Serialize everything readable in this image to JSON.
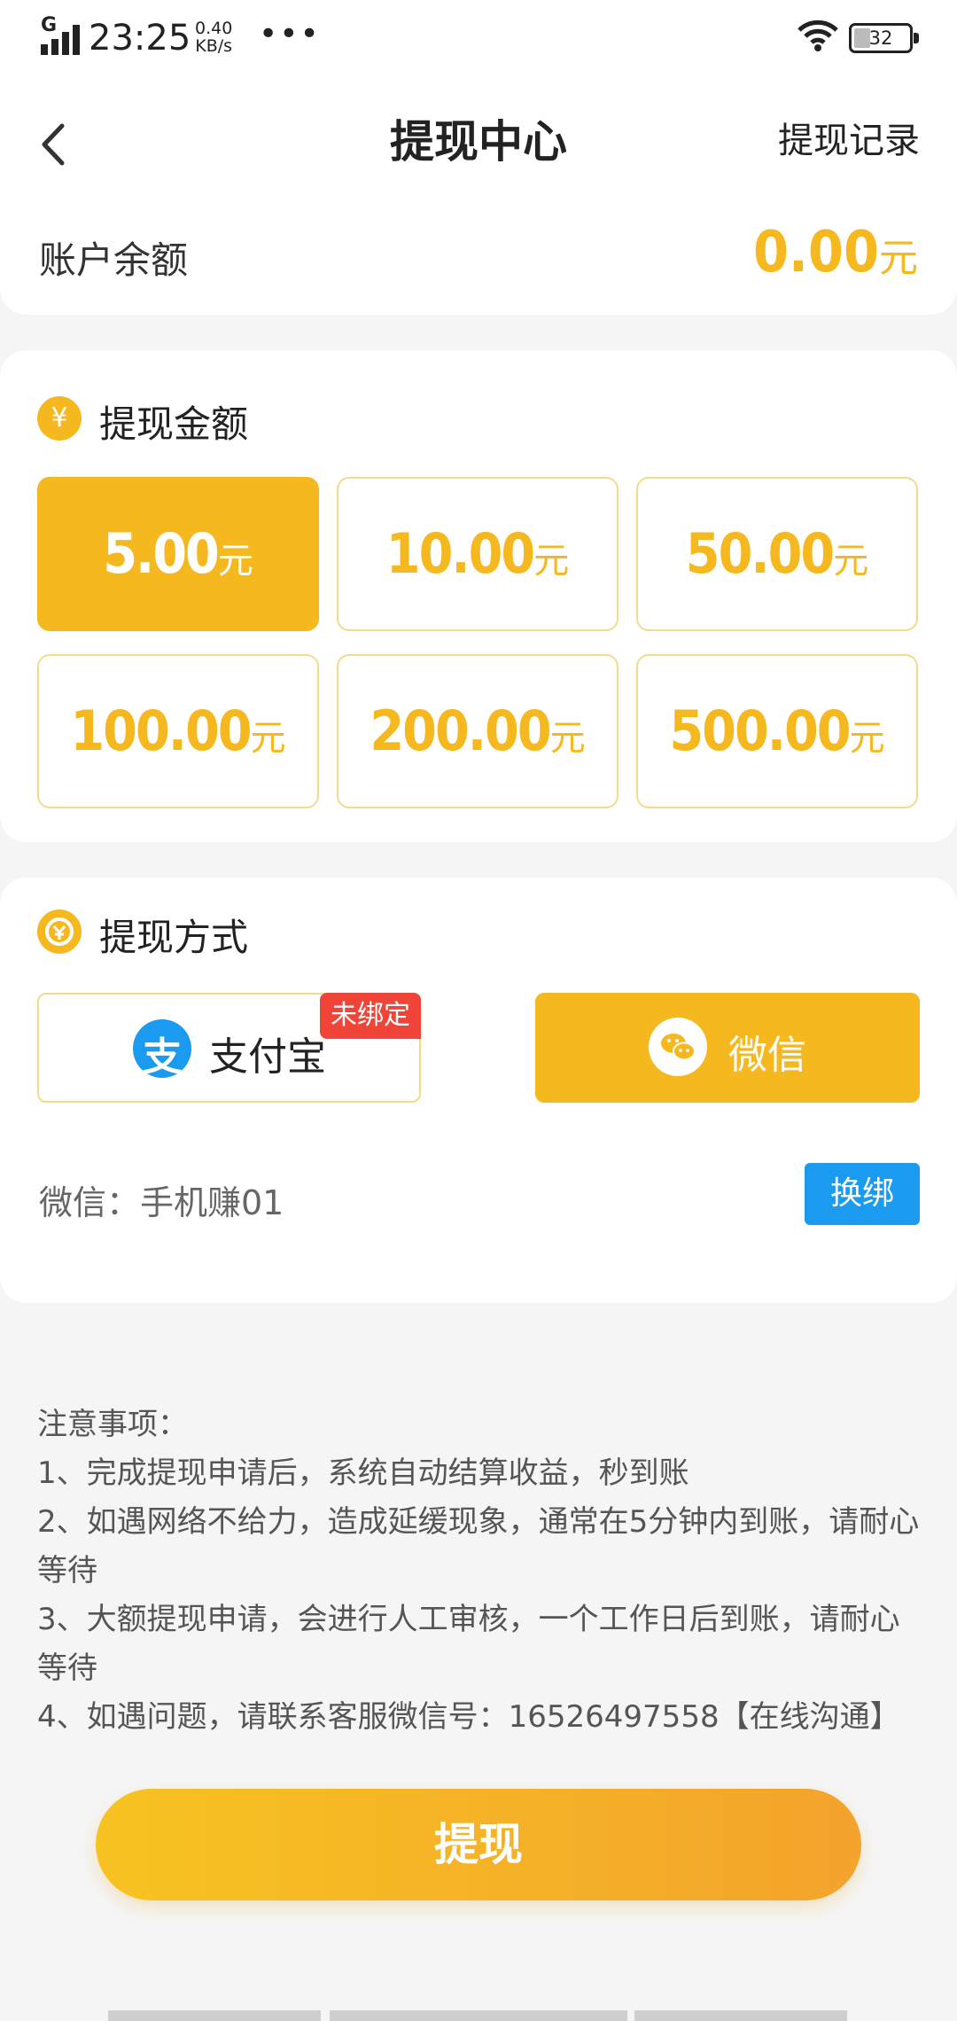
{
  "status_bar": {
    "network": "G",
    "time": "23:25",
    "speed_value": "0.40",
    "speed_unit": "KB/s",
    "more": "•••",
    "battery": "32"
  },
  "header": {
    "title": "提现中心",
    "record_link": "提现记录"
  },
  "balance": {
    "label": "账户余额",
    "value": "0.00",
    "unit": "元"
  },
  "amount_section": {
    "icon": "yen-coin-icon",
    "icon_glyph": "¥",
    "title": "提现金额",
    "unit": "元",
    "selected_index": 0,
    "options": [
      "5.00",
      "10.00",
      "50.00",
      "100.00",
      "200.00",
      "500.00"
    ]
  },
  "method_section": {
    "icon": "coin-bag-icon",
    "title": "提现方式",
    "alipay": {
      "logo_glyph": "支",
      "label": "支付宝",
      "badge": "未绑定"
    },
    "wechat": {
      "label": "微信",
      "selected": true
    },
    "account": "微信：手机赚01",
    "rebind_label": "换绑"
  },
  "notes": {
    "title": "注意事项：",
    "items": [
      "1、完成提现申请后，系统自动结算收益，秒到账",
      "2、如遇网络不给力，造成延缓现象，通常在5分钟内到账，请耐心等待",
      "3、大额提现申请，会进行人工审核，一个工作日后到账，请耐心等待",
      "4、如遇问题，请联系客服微信号：16526497558【在线沟通】"
    ]
  },
  "submit_label": "提现",
  "colors": {
    "accent": "#f5b81f",
    "blue": "#1a9bf0",
    "badge_red": "#f04438"
  }
}
